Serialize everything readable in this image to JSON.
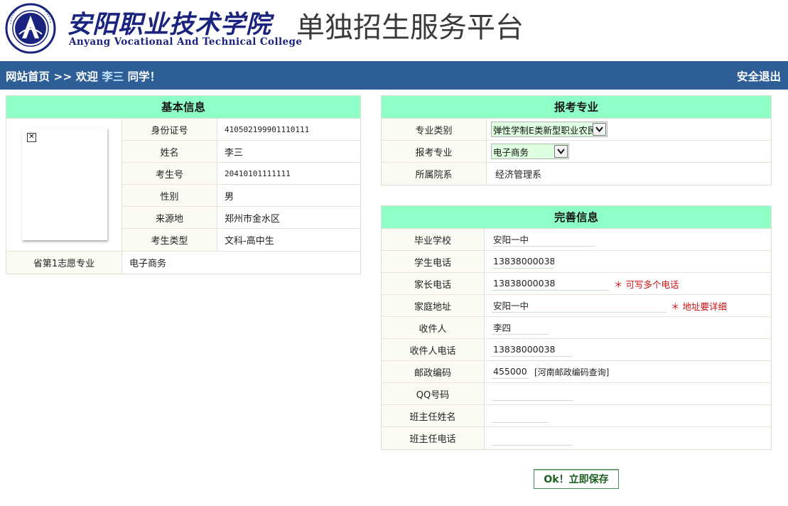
{
  "header": {
    "school_name_cn": "安阳职业技术学院",
    "school_name_en": "Anyang Vocational And Technical College",
    "platform_title": "单独招生服务平台"
  },
  "nav": {
    "home": "网站首页",
    "separator": ">>",
    "welcome": "欢迎",
    "username": "李三",
    "suffix": "同学！",
    "logout": "安全退出"
  },
  "basic_info": {
    "title": "基本信息",
    "fields": [
      {
        "label": "身份证号",
        "value": "410502199901110111"
      },
      {
        "label": "姓名",
        "value": "李三"
      },
      {
        "label": "考生号",
        "value": "20410101111111"
      },
      {
        "label": "性别",
        "value": "男"
      },
      {
        "label": "来源地",
        "value": "郑州市金水区"
      },
      {
        "label": "考生类型",
        "value": "文科-高中生"
      }
    ],
    "first_choice": {
      "label": "省第1志愿专业",
      "value": "电子商务"
    }
  },
  "major": {
    "title": "报考专业",
    "category": {
      "label": "专业类别",
      "value": "弹性学制E类新型职业农民"
    },
    "major": {
      "label": "报考专业",
      "value": "电子商务"
    },
    "department": {
      "label": "所属院系",
      "value": "经济管理系"
    }
  },
  "complete_info": {
    "title": "完善信息",
    "graduate_school": {
      "label": "毕业学校",
      "value": "安阳一中"
    },
    "student_phone": {
      "label": "学生电话",
      "value": "13838000038"
    },
    "parent_phone": {
      "label": "家长电话",
      "value": "13838000038",
      "hint": "＊ 可写多个电话"
    },
    "home_address": {
      "label": "家庭地址",
      "value": "安阳一中",
      "hint": "＊ 地址要详细"
    },
    "recipient": {
      "label": "收件人",
      "value": "李四"
    },
    "recipient_phone": {
      "label": "收件人电话",
      "value": "13838000038"
    },
    "postcode": {
      "label": "邮政编码",
      "value": "455000",
      "link": "[河南邮政编码查询]"
    },
    "qq": {
      "label": "QQ号码",
      "value": ""
    },
    "teacher_name": {
      "label": "班主任姓名",
      "value": ""
    },
    "teacher_phone": {
      "label": "班主任电话",
      "value": ""
    }
  },
  "save_button": "Ok！立即保存",
  "colors": {
    "nav_bg": "#2d5f96",
    "panel_header_bg": "#8effc7",
    "select_bg": "#dfffe1",
    "hint_red": "#cc1111",
    "logo_blue": "#1a237e"
  }
}
